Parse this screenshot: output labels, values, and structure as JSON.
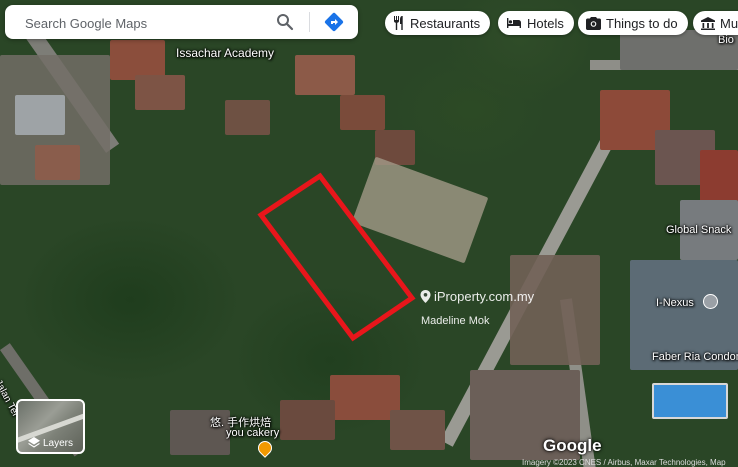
{
  "search": {
    "placeholder": "Search Google Maps"
  },
  "chips": [
    {
      "icon": "restaurant-icon",
      "label": "Restaurants"
    },
    {
      "icon": "hotel-icon",
      "label": "Hotels"
    },
    {
      "icon": "camera-icon",
      "label": "Things to do"
    },
    {
      "icon": "museum-icon",
      "label": "Mu"
    }
  ],
  "places": {
    "issachar": "Issachar Academy",
    "global_snack": "Global Snack",
    "inexus": "I-Nexus",
    "faber": "Faber Ria Condomin",
    "bio": "Bio",
    "cakery_cn": "悠. 手作烘焙",
    "cakery_en": "you cakery",
    "street": "Jalan Tel"
  },
  "watermark": {
    "site": "iProperty.com.my",
    "agent": "Madeline Mok"
  },
  "layers_label": "Layers",
  "google_logo": "Google",
  "attribution": "Imagery ©2023 CNES / Airbus, Maxar Technologies, Map",
  "colors": {
    "highlight": "#e8161b",
    "chip_bg": "#ffffff",
    "map_green": "#2a4626"
  }
}
